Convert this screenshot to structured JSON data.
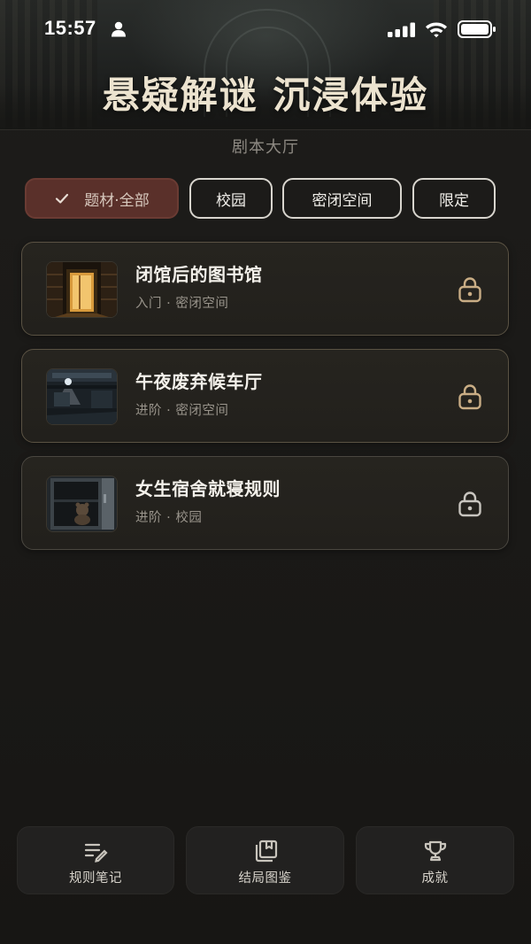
{
  "status_bar": {
    "time": "15:57"
  },
  "hero": {
    "title": "悬疑解谜 沉浸体验"
  },
  "hall": {
    "subtitle": "剧本大厅"
  },
  "filters": [
    {
      "label": "题材·全部",
      "selected": true
    },
    {
      "label": "校园",
      "selected": false
    },
    {
      "label": "密闭空间",
      "selected": false
    },
    {
      "label": "限定",
      "selected": false
    }
  ],
  "stories": [
    {
      "title": "闭馆后的图书馆",
      "meta": "入门 · 密闭空间",
      "locked": true,
      "thumb_icon": "library-door-thumbnail"
    },
    {
      "title": "午夜废弃候车厅",
      "meta": "进阶 · 密闭空间",
      "locked": true,
      "thumb_icon": "abandoned-station-thumbnail"
    },
    {
      "title": "女生宿舍就寝规则",
      "meta": "进阶 · 校园",
      "locked": true,
      "thumb_icon": "dorm-locker-thumbnail"
    }
  ],
  "bottom_nav": [
    {
      "label": "规则笔记",
      "icon": "notes-pen-icon"
    },
    {
      "label": "结局图鉴",
      "icon": "book-stack-icon"
    },
    {
      "label": "成就",
      "icon": "trophy-icon"
    }
  ],
  "colors": {
    "background": "#1a1917",
    "accent_chip": "#5a302a",
    "card_border": "#5a5243",
    "lock_gold": "#c9ad85",
    "lock_gray": "#c8c5bf"
  }
}
